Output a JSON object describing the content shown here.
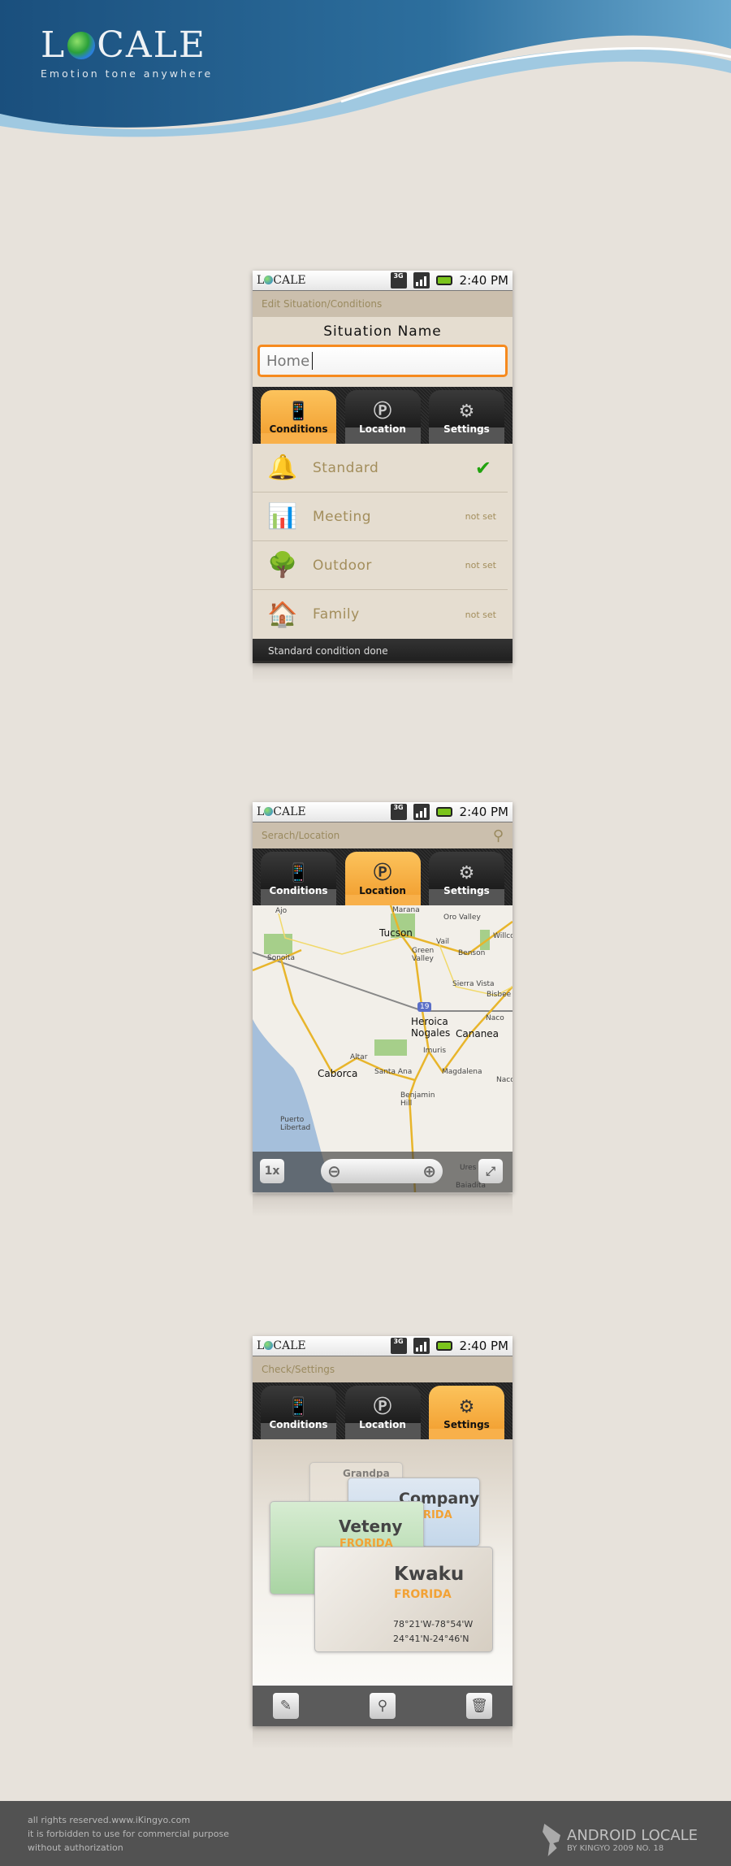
{
  "brand": {
    "logo": "LOCALE",
    "tagline": "Emotion tone anywhere"
  },
  "status": {
    "network": "3G",
    "time": "2:40 PM",
    "logo": "LOCALE"
  },
  "tabs": [
    "Conditions",
    "Location",
    "Settings"
  ],
  "screen1": {
    "header": "Edit Situation/Conditions",
    "field_label": "Situation Name",
    "field_value": "Home",
    "rows": [
      {
        "label": "Standard",
        "status": "✔",
        "icon": "bell-icon"
      },
      {
        "label": "Meeting",
        "status": "not set",
        "icon": "easel-icon"
      },
      {
        "label": "Outdoor",
        "status": "not set",
        "icon": "tree-icon"
      },
      {
        "label": "Family",
        "status": "not set",
        "icon": "house-icon"
      }
    ],
    "footer": "Standard condition done"
  },
  "screen2": {
    "header": "Serach/Location",
    "zoom_label": "1x",
    "map_labels": [
      "Ajo",
      "Marana",
      "Oro Valley",
      "Tucson",
      "Vail",
      "Willcox",
      "Green Valley",
      "Benson",
      "Sonoita",
      "Sierra Vista",
      "Bisbee",
      "Heroica Nogales",
      "Naco",
      "Cananea",
      "Imuris",
      "Altar",
      "Caborca",
      "Santa Ana",
      "Magdalena",
      "Benjamin Hill",
      "Puerto Libertad",
      "Nacozari de G",
      "Ures",
      "Baiadita",
      "19"
    ]
  },
  "screen3": {
    "header": "Check/Settings",
    "cards": [
      {
        "name": "Grandpa"
      },
      {
        "name": "Company",
        "state": "FRORIDA"
      },
      {
        "name": "Veteny",
        "state": "FRORIDA"
      },
      {
        "name": "Kwaku",
        "state": "FRORIDA",
        "lon": "78°21'W-78°54'W",
        "lat": "24°41'N-24°46'N"
      }
    ]
  },
  "footer": {
    "lines": [
      "all rights reserved.www.iKingyo.com",
      "it is forbidden to use for commercial purpose",
      "without authorization"
    ],
    "title": "ANDROID LOCALE",
    "subtitle": "BY KINGYO 2009 NO. 18"
  },
  "colors": {
    "accent": "#f3a335",
    "banner": "#1d5a8a",
    "footer": "#525252"
  }
}
